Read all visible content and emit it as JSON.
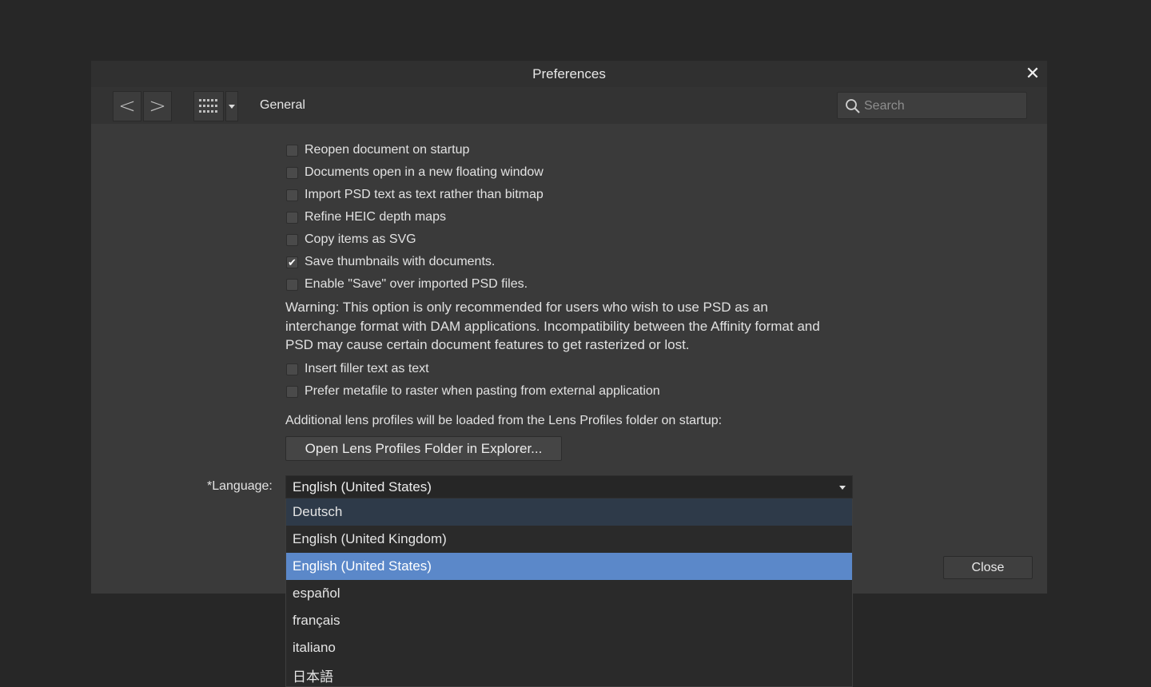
{
  "dialog": {
    "title": "Preferences",
    "close_icon": "close-icon",
    "section": "General",
    "search_placeholder": "Search"
  },
  "toolbar": {
    "back": "<",
    "forward": ">"
  },
  "options": [
    {
      "label": "Reopen document on startup",
      "checked": false
    },
    {
      "label": "Documents open in a new floating window",
      "checked": false
    },
    {
      "label": "Import PSD text as text rather than bitmap",
      "checked": false
    },
    {
      "label": "Refine HEIC depth maps",
      "checked": false
    },
    {
      "label": "Copy items as SVG",
      "checked": false
    },
    {
      "label": "Save thumbnails with documents.",
      "checked": true
    },
    {
      "label": "Enable \"Save\" over imported PSD files.",
      "checked": false
    },
    {
      "label": "Insert filler text as text",
      "checked": false
    },
    {
      "label": "Prefer metafile to raster when pasting from external application",
      "checked": false
    }
  ],
  "warning": "Warning: This option is only recommended for users who wish to use PSD as an interchange format with DAM applications. Incompatibility between the Affinity format and PSD may cause certain document features to get rasterized or lost.",
  "lens": {
    "note": "Additional lens profiles will be loaded from the Lens Profiles folder on startup:",
    "button": "Open Lens Profiles Folder in Explorer..."
  },
  "language": {
    "label": "*Language:",
    "selected": "English (United States)",
    "choices": [
      "Deutsch",
      "English (United Kingdom)",
      "English (United States)",
      "español",
      "français",
      "italiano",
      "日本語"
    ],
    "hover_index": 0,
    "selected_index": 2
  },
  "footer": {
    "close": "Close"
  },
  "colors": {
    "selected": "#5b88c9",
    "hover": "#2e3a49"
  }
}
